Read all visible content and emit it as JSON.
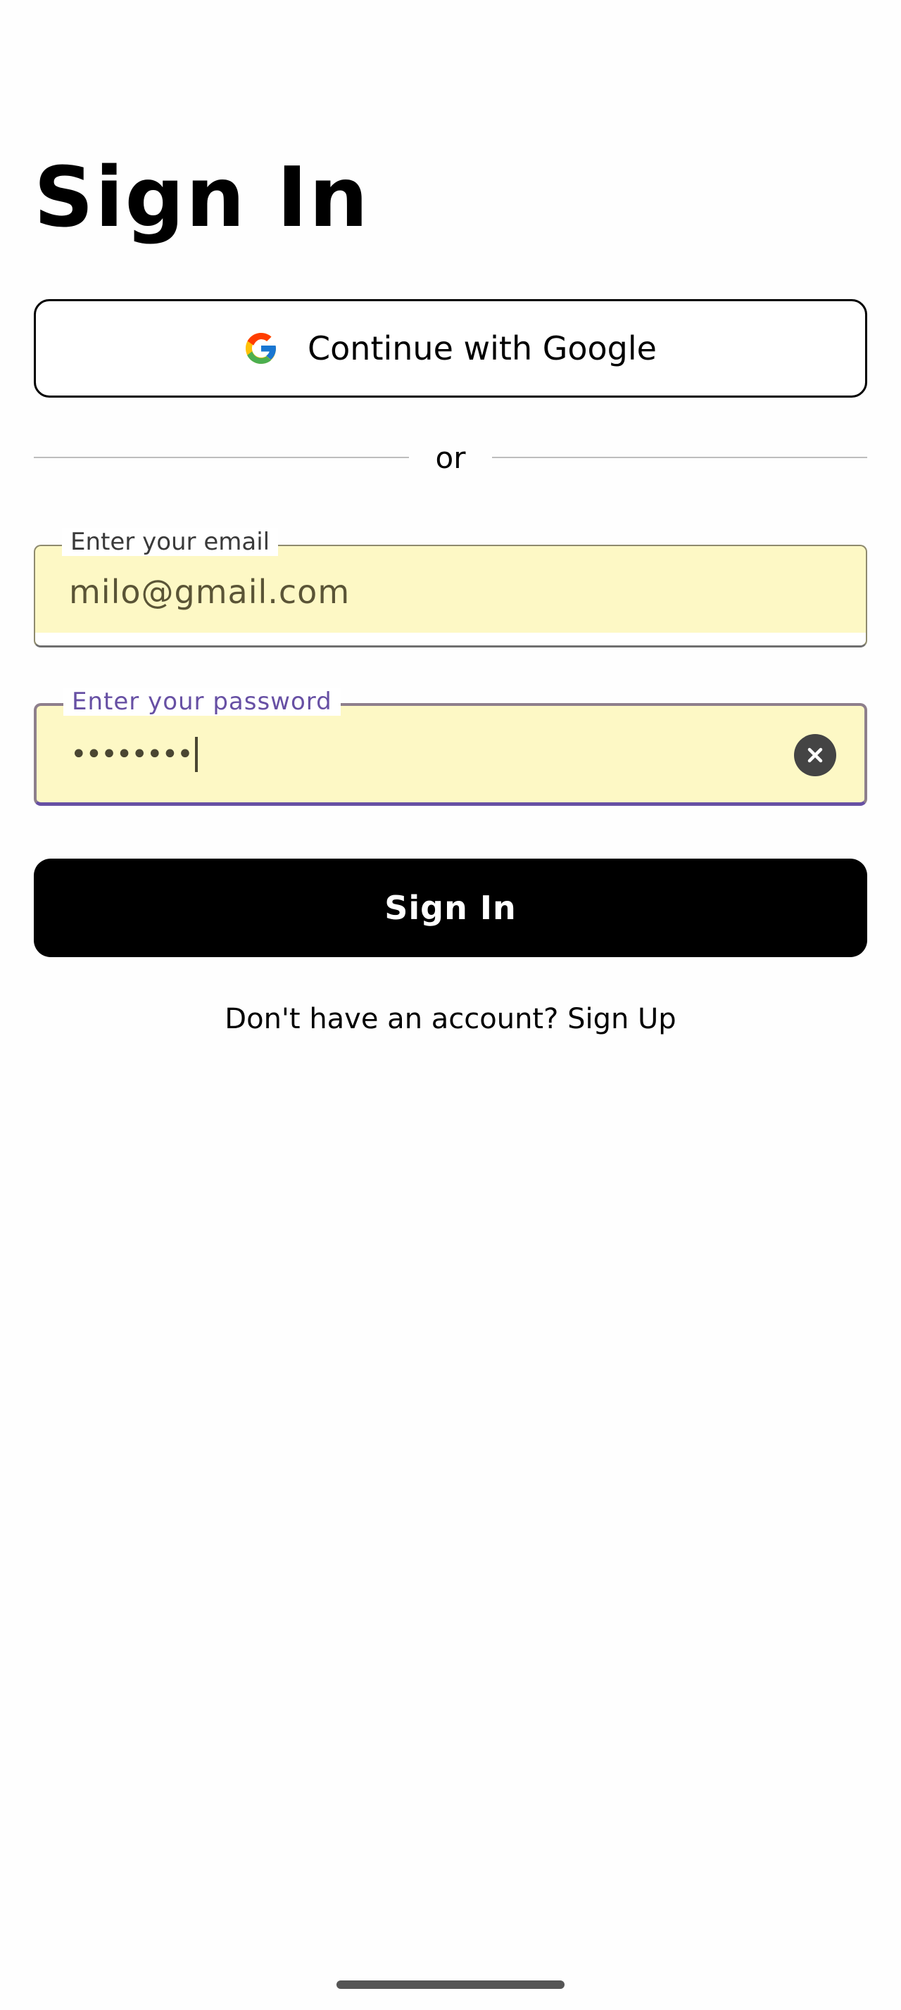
{
  "page": {
    "title": "Sign In"
  },
  "google_button": {
    "label": "Continue with Google",
    "icon": "google-icon"
  },
  "divider": {
    "text": "or"
  },
  "email_field": {
    "label": "Enter your email",
    "value": "milo@gmail.com"
  },
  "password_field": {
    "label": "Enter your password",
    "masked_value": "••••••••",
    "clear_icon": "close-circle-icon"
  },
  "sign_in_button": {
    "label": "Sign In"
  },
  "signup_prompt": {
    "text": "Don't have an account?",
    "link": "Sign Up"
  },
  "colors": {
    "field_background": "#fdf8c5",
    "focus_accent": "#6750a4",
    "primary_button": "#000000"
  }
}
